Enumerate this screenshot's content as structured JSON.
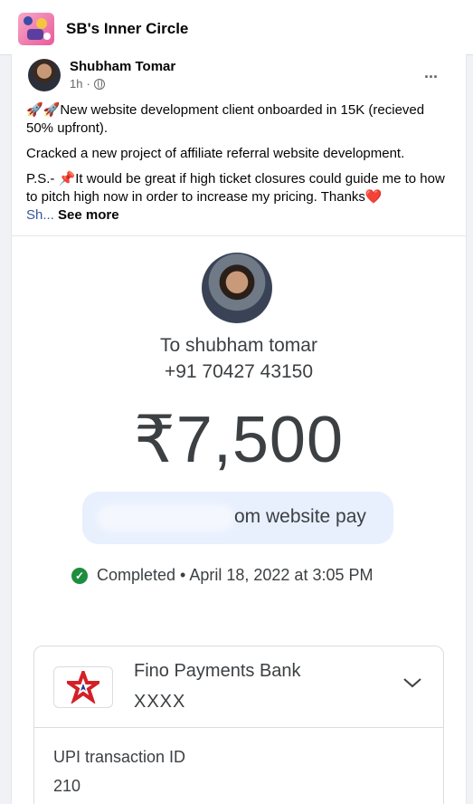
{
  "group": {
    "name": "SB's Inner Circle"
  },
  "post": {
    "author": "Shubham Tomar",
    "time": "1h",
    "line1": "🚀🚀New website development client onboarded in 15K (recieved 50% upfront).",
    "line2": "Cracked a new project of affiliate referral website development.",
    "line3": "P.S.- 📌It would be great if high ticket closures could guide me to how to pitch high now in order to increase my pricing. Thanks❤️",
    "truncated": "Sh...",
    "see_more": "See more",
    "more_icon": "..."
  },
  "payment": {
    "to": "To shubham tomar",
    "phone": "+91 70427 43150",
    "amount": "₹7,500",
    "note": "om website pay",
    "status": "Completed • April 18, 2022 at 3:05 PM",
    "bank_name": "Fino Payments Bank",
    "account": "XXXX",
    "upi_label": "UPI transaction ID",
    "upi_value": "210"
  },
  "colors": {
    "success": "#1e8e3e",
    "note_bg": "#e8f0fe",
    "bank_logo_red": "#d32027",
    "bank_logo_blue": "#1b3f8f"
  }
}
